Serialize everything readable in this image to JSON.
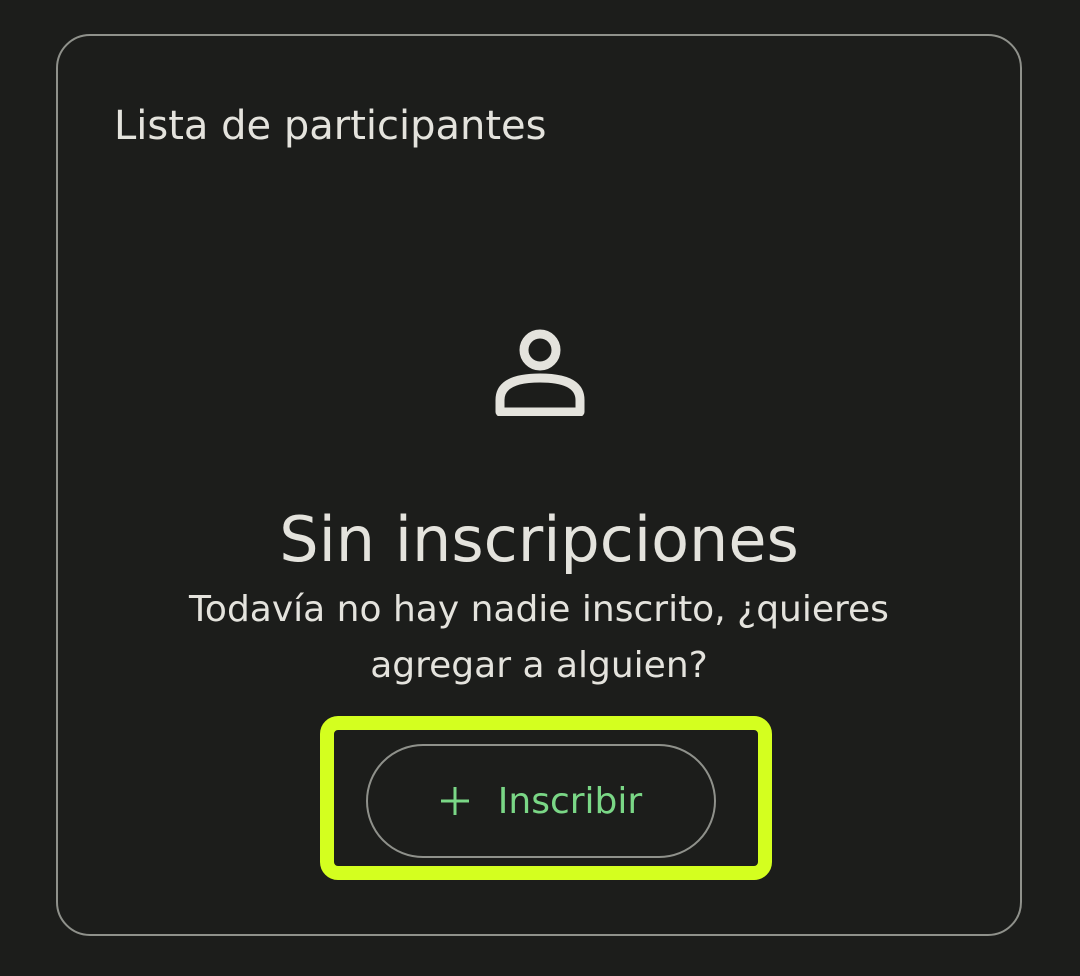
{
  "card": {
    "title": "Lista de participantes"
  },
  "empty_state": {
    "icon": "person-outline-icon",
    "title": "Sin inscripciones",
    "description": "Todavía no hay nadie inscrito, ¿quieres agregar a alguien?"
  },
  "actions": {
    "enroll_label": "Inscribir",
    "enroll_icon": "plus-icon"
  },
  "colors": {
    "background": "#1c1d1b",
    "text": "#e4e3dd",
    "border": "#8f918b",
    "accent": "#7ad786",
    "highlight": "#d4ff1f"
  }
}
